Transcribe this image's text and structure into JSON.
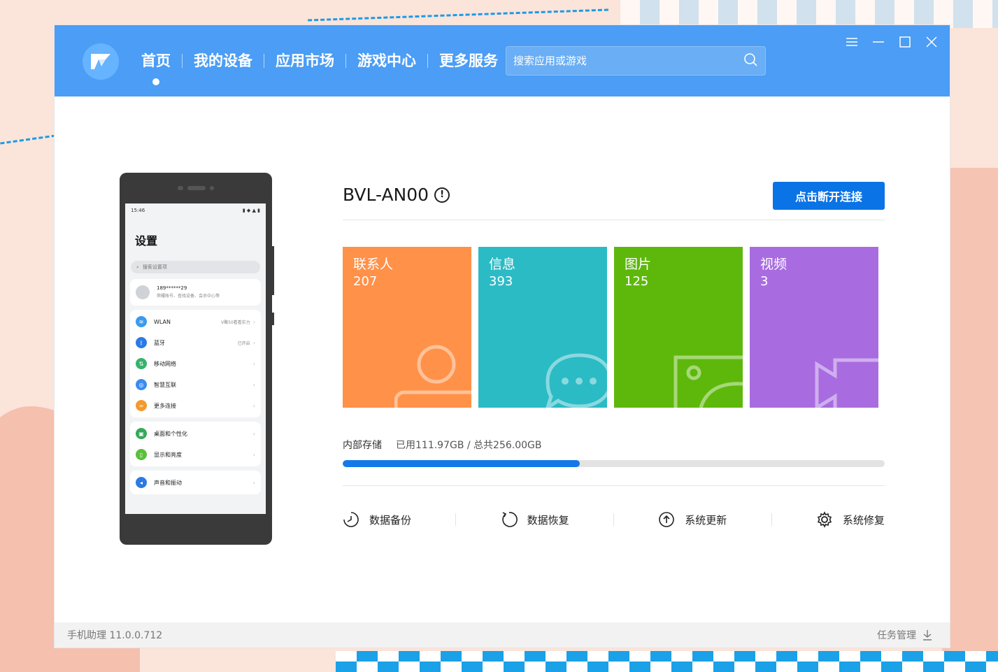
{
  "nav": {
    "items": [
      {
        "label": "首页",
        "active": true
      },
      {
        "label": "我的设备",
        "active": false
      },
      {
        "label": "应用市场",
        "active": false
      },
      {
        "label": "游戏中心",
        "active": false
      },
      {
        "label": "更多服务",
        "active": false
      }
    ]
  },
  "search": {
    "placeholder": "搜索应用或游戏"
  },
  "phone": {
    "time": "15:46",
    "title": "设置",
    "search_placeholder": "搜索设置项",
    "account": {
      "number": "189******29",
      "subtitle": "荣耀账号、查找设备、会员中心等"
    },
    "rows": [
      {
        "label": "WLAN",
        "value": "V聚50看看实力",
        "color": "#3b9af0"
      },
      {
        "label": "蓝牙",
        "value": "已开启",
        "color": "#2a7be4"
      },
      {
        "label": "移动网络",
        "value": "",
        "color": "#36b36b"
      },
      {
        "label": "智慧互联",
        "value": "",
        "color": "#3b8bf0"
      },
      {
        "label": "更多连接",
        "value": "",
        "color": "#f39a2d"
      },
      {
        "label": "桌面和个性化",
        "value": "",
        "color": "#35a85c"
      },
      {
        "label": "显示和亮度",
        "value": "",
        "color": "#5cbf3b"
      },
      {
        "label": "声音和振动",
        "value": "",
        "color": "#2a7be4"
      }
    ]
  },
  "device": {
    "name": "BVL-AN00",
    "disconnect_label": "点击断开连接"
  },
  "tiles": [
    {
      "label": "联系人",
      "count": "207",
      "color": "#ff9148",
      "icon": "contact-icon"
    },
    {
      "label": "信息",
      "count": "393",
      "color": "#2bbbc5",
      "icon": "message-icon"
    },
    {
      "label": "图片",
      "count": "125",
      "color": "#5eb80c",
      "icon": "image-icon"
    },
    {
      "label": "视频",
      "count": "3",
      "color": "#a86ce0",
      "icon": "video-icon"
    }
  ],
  "storage": {
    "label": "内部存储",
    "value_text": "已用111.97GB / 总共256.00GB",
    "used_fraction": 0.4374
  },
  "actions": [
    {
      "label": "数据备份",
      "icon": "backup-icon"
    },
    {
      "label": "数据恢复",
      "icon": "restore-icon"
    },
    {
      "label": "系统更新",
      "icon": "update-icon"
    },
    {
      "label": "系统修复",
      "icon": "repair-gear-icon"
    }
  ],
  "status": {
    "version": "手机助理 11.0.0.712",
    "task_manager": "任务管理"
  },
  "colors": {
    "titlebar": "#4b9df5",
    "primary": "#0a73e6"
  }
}
